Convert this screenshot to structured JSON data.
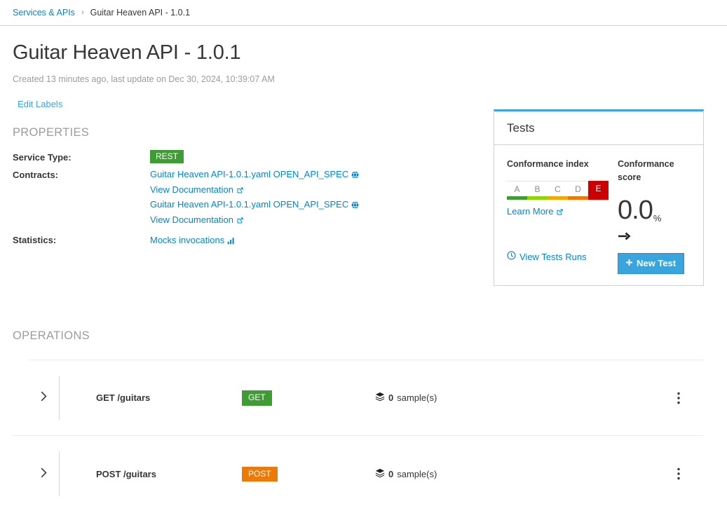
{
  "breadcrumb": {
    "root_label": "Services & APIs",
    "separator": "›",
    "current_label": "Guitar Heaven API - 1.0.1"
  },
  "header": {
    "title": "Guitar Heaven API - 1.0.1",
    "subtitle": "Created 13 minutes ago, last update on Dec 30, 2024, 10:39:07 AM",
    "edit_labels_label": "Edit Labels"
  },
  "properties": {
    "section_label": "PROPERTIES",
    "service_type_key": "Service Type:",
    "service_type_value": "REST",
    "contracts_key": "Contracts:",
    "contracts": [
      {
        "label": "Guitar Heaven API-1.0.1.yaml OPEN_API_SPEC",
        "icon": "globe-icon"
      },
      {
        "label": "View Documentation",
        "icon": "external-link-icon"
      },
      {
        "label": "Guitar Heaven API-1.0.1.yaml OPEN_API_SPEC",
        "icon": "globe-icon"
      },
      {
        "label": "View Documentation",
        "icon": "external-link-icon"
      }
    ],
    "statistics_key": "Statistics:",
    "statistics_label": "Mocks invocations",
    "statistics_icon": "bar-chart-icon"
  },
  "tests": {
    "card_title": "Tests",
    "conformance_index_label": "Conformance index",
    "conformance_score_label": "Conformance score",
    "grades": [
      {
        "letter": "A",
        "color": "#3f9c35"
      },
      {
        "letter": "B",
        "color": "#92d400"
      },
      {
        "letter": "C",
        "color": "#f0ab00"
      },
      {
        "letter": "D",
        "color": "#ec7a08"
      },
      {
        "letter": "E",
        "color": "#cc0000"
      }
    ],
    "active_grade": "E",
    "learn_more_label": "Learn More",
    "view_tests_runs_label": "View Tests Runs",
    "score_value": "0.0",
    "score_unit": "%",
    "trend_direction": "flat",
    "new_test_label": "New Test"
  },
  "operations": {
    "section_label": "OPERATIONS",
    "samples_suffix": "sample(s)",
    "rows": [
      {
        "name": "GET /guitars",
        "verb": "GET",
        "verb_color": "#3f9c35",
        "samples_count": "0",
        "samples_suffix": "sample(s)"
      },
      {
        "name": "POST /guitars",
        "verb": "POST",
        "verb_color": "#ec7a08",
        "samples_count": "0",
        "samples_suffix": "sample(s)"
      }
    ]
  },
  "colors": {
    "accent_blue": "#39a5dc",
    "link_blue": "#0088ce",
    "green": "#3f9c35",
    "orange": "#ec7a08",
    "red": "#cc0000"
  }
}
